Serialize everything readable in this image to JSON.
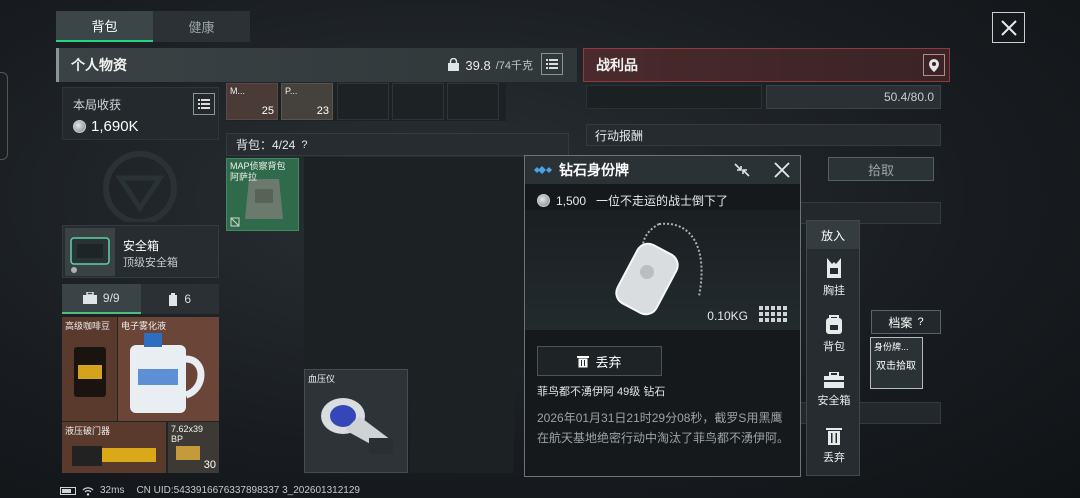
{
  "tabs": [
    {
      "label": "背包"
    },
    {
      "label": "健康"
    }
  ],
  "left_panel": {
    "title": "个人物资",
    "weight_value": "39.8",
    "weight_max": "/74千克",
    "income_label": "本局收获",
    "income_value": "1,690K",
    "top_items": [
      {
        "name": "M...",
        "qty": "25"
      },
      {
        "name": "P...",
        "qty": "23"
      }
    ],
    "safe_box": {
      "name": "安全箱",
      "subtitle": "顶级安全箱"
    },
    "container_tabs": [
      {
        "label": "9/9"
      },
      {
        "label": "6"
      }
    ],
    "items": [
      {
        "name": "高级咖啡豆"
      },
      {
        "name": "电子雾化液"
      },
      {
        "name": "液压破门器"
      },
      {
        "name": "7.62x39 BP",
        "qty": "30"
      }
    ],
    "backpack_header": "背包：4/24",
    "backpack_header_help": "?",
    "backpack_item": {
      "name": "MAP侦察背包",
      "name2": "阿萨拉"
    },
    "bp_item2": {
      "name": "血压仪"
    }
  },
  "right_panel": {
    "title": "战利品",
    "top_value": "50.4/80.0",
    "reward_label": "行动报酬",
    "pickup_label": "拾取"
  },
  "popup": {
    "title": "钻石身份牌",
    "price": "1,500",
    "flavor": "一位不走运的战士倒下了",
    "weight": "0.10KG",
    "discard_label": "丢弃",
    "owner": "菲鸟都不湧伊阿  49级  钻石",
    "description": "2026年01月31日21时29分08秒，截罗S用黑鹰在航天基地绝密行动中淘汰了菲鸟都不湧伊阿。"
  },
  "actions": {
    "header": "放入",
    "items": [
      {
        "label": "胸挂"
      },
      {
        "label": "背包"
      },
      {
        "label": "安全箱"
      },
      {
        "label": "丢弃"
      }
    ]
  },
  "archive": {
    "label": "档案",
    "help": "?",
    "slot_name": "身份牌...",
    "slot_hint": "双击拾取"
  },
  "status": {
    "ping": "32ms",
    "uid": "CN UID:5433916676337898337 3_202601312129"
  },
  "colors": {
    "accent": "#24d67a",
    "loot_header": "#8e3a3e",
    "diamond": "#4aa3e8"
  }
}
